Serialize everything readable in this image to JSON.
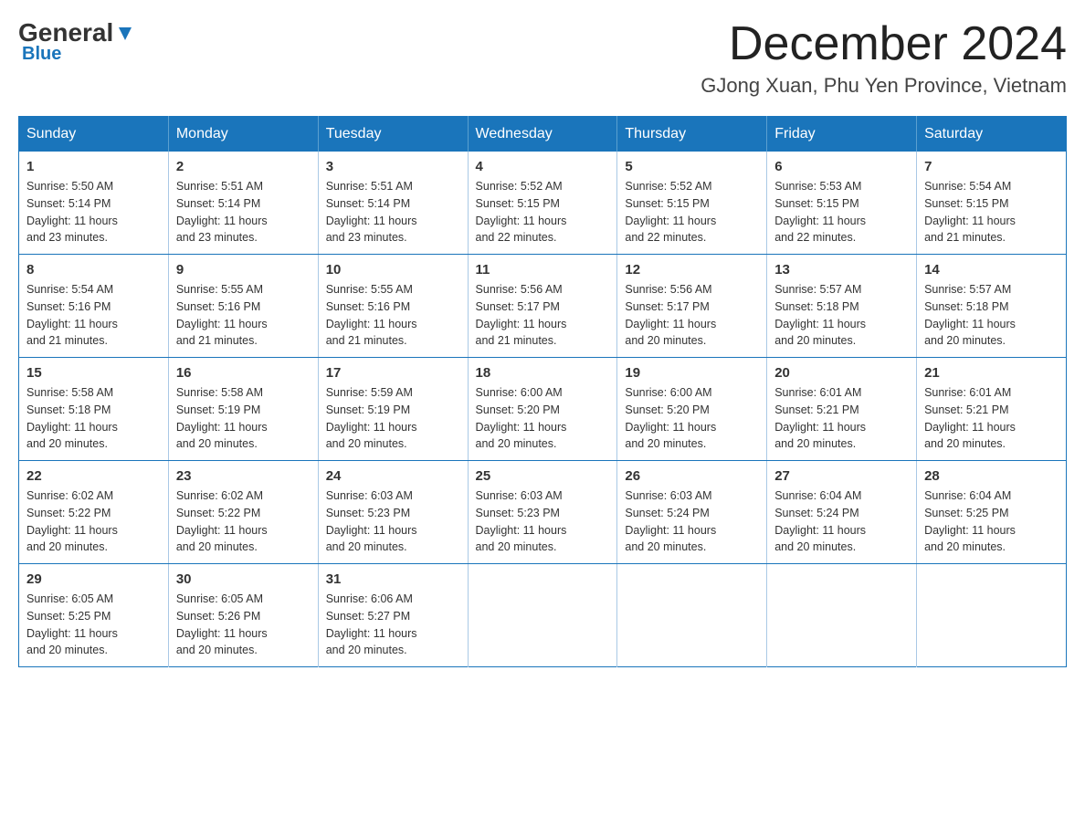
{
  "header": {
    "logo_general": "General",
    "logo_blue": "Blue",
    "month_title": "December 2024",
    "location": "GJong Xuan, Phu Yen Province, Vietnam"
  },
  "weekdays": [
    "Sunday",
    "Monday",
    "Tuesday",
    "Wednesday",
    "Thursday",
    "Friday",
    "Saturday"
  ],
  "weeks": [
    [
      {
        "day": "1",
        "sunrise": "5:50 AM",
        "sunset": "5:14 PM",
        "daylight": "11 hours and 23 minutes."
      },
      {
        "day": "2",
        "sunrise": "5:51 AM",
        "sunset": "5:14 PM",
        "daylight": "11 hours and 23 minutes."
      },
      {
        "day": "3",
        "sunrise": "5:51 AM",
        "sunset": "5:14 PM",
        "daylight": "11 hours and 23 minutes."
      },
      {
        "day": "4",
        "sunrise": "5:52 AM",
        "sunset": "5:15 PM",
        "daylight": "11 hours and 22 minutes."
      },
      {
        "day": "5",
        "sunrise": "5:52 AM",
        "sunset": "5:15 PM",
        "daylight": "11 hours and 22 minutes."
      },
      {
        "day": "6",
        "sunrise": "5:53 AM",
        "sunset": "5:15 PM",
        "daylight": "11 hours and 22 minutes."
      },
      {
        "day": "7",
        "sunrise": "5:54 AM",
        "sunset": "5:15 PM",
        "daylight": "11 hours and 21 minutes."
      }
    ],
    [
      {
        "day": "8",
        "sunrise": "5:54 AM",
        "sunset": "5:16 PM",
        "daylight": "11 hours and 21 minutes."
      },
      {
        "day": "9",
        "sunrise": "5:55 AM",
        "sunset": "5:16 PM",
        "daylight": "11 hours and 21 minutes."
      },
      {
        "day": "10",
        "sunrise": "5:55 AM",
        "sunset": "5:16 PM",
        "daylight": "11 hours and 21 minutes."
      },
      {
        "day": "11",
        "sunrise": "5:56 AM",
        "sunset": "5:17 PM",
        "daylight": "11 hours and 21 minutes."
      },
      {
        "day": "12",
        "sunrise": "5:56 AM",
        "sunset": "5:17 PM",
        "daylight": "11 hours and 20 minutes."
      },
      {
        "day": "13",
        "sunrise": "5:57 AM",
        "sunset": "5:18 PM",
        "daylight": "11 hours and 20 minutes."
      },
      {
        "day": "14",
        "sunrise": "5:57 AM",
        "sunset": "5:18 PM",
        "daylight": "11 hours and 20 minutes."
      }
    ],
    [
      {
        "day": "15",
        "sunrise": "5:58 AM",
        "sunset": "5:18 PM",
        "daylight": "11 hours and 20 minutes."
      },
      {
        "day": "16",
        "sunrise": "5:58 AM",
        "sunset": "5:19 PM",
        "daylight": "11 hours and 20 minutes."
      },
      {
        "day": "17",
        "sunrise": "5:59 AM",
        "sunset": "5:19 PM",
        "daylight": "11 hours and 20 minutes."
      },
      {
        "day": "18",
        "sunrise": "6:00 AM",
        "sunset": "5:20 PM",
        "daylight": "11 hours and 20 minutes."
      },
      {
        "day": "19",
        "sunrise": "6:00 AM",
        "sunset": "5:20 PM",
        "daylight": "11 hours and 20 minutes."
      },
      {
        "day": "20",
        "sunrise": "6:01 AM",
        "sunset": "5:21 PM",
        "daylight": "11 hours and 20 minutes."
      },
      {
        "day": "21",
        "sunrise": "6:01 AM",
        "sunset": "5:21 PM",
        "daylight": "11 hours and 20 minutes."
      }
    ],
    [
      {
        "day": "22",
        "sunrise": "6:02 AM",
        "sunset": "5:22 PM",
        "daylight": "11 hours and 20 minutes."
      },
      {
        "day": "23",
        "sunrise": "6:02 AM",
        "sunset": "5:22 PM",
        "daylight": "11 hours and 20 minutes."
      },
      {
        "day": "24",
        "sunrise": "6:03 AM",
        "sunset": "5:23 PM",
        "daylight": "11 hours and 20 minutes."
      },
      {
        "day": "25",
        "sunrise": "6:03 AM",
        "sunset": "5:23 PM",
        "daylight": "11 hours and 20 minutes."
      },
      {
        "day": "26",
        "sunrise": "6:03 AM",
        "sunset": "5:24 PM",
        "daylight": "11 hours and 20 minutes."
      },
      {
        "day": "27",
        "sunrise": "6:04 AM",
        "sunset": "5:24 PM",
        "daylight": "11 hours and 20 minutes."
      },
      {
        "day": "28",
        "sunrise": "6:04 AM",
        "sunset": "5:25 PM",
        "daylight": "11 hours and 20 minutes."
      }
    ],
    [
      {
        "day": "29",
        "sunrise": "6:05 AM",
        "sunset": "5:25 PM",
        "daylight": "11 hours and 20 minutes."
      },
      {
        "day": "30",
        "sunrise": "6:05 AM",
        "sunset": "5:26 PM",
        "daylight": "11 hours and 20 minutes."
      },
      {
        "day": "31",
        "sunrise": "6:06 AM",
        "sunset": "5:27 PM",
        "daylight": "11 hours and 20 minutes."
      },
      null,
      null,
      null,
      null
    ]
  ],
  "labels": {
    "sunrise": "Sunrise:",
    "sunset": "Sunset:",
    "daylight": "Daylight:"
  }
}
